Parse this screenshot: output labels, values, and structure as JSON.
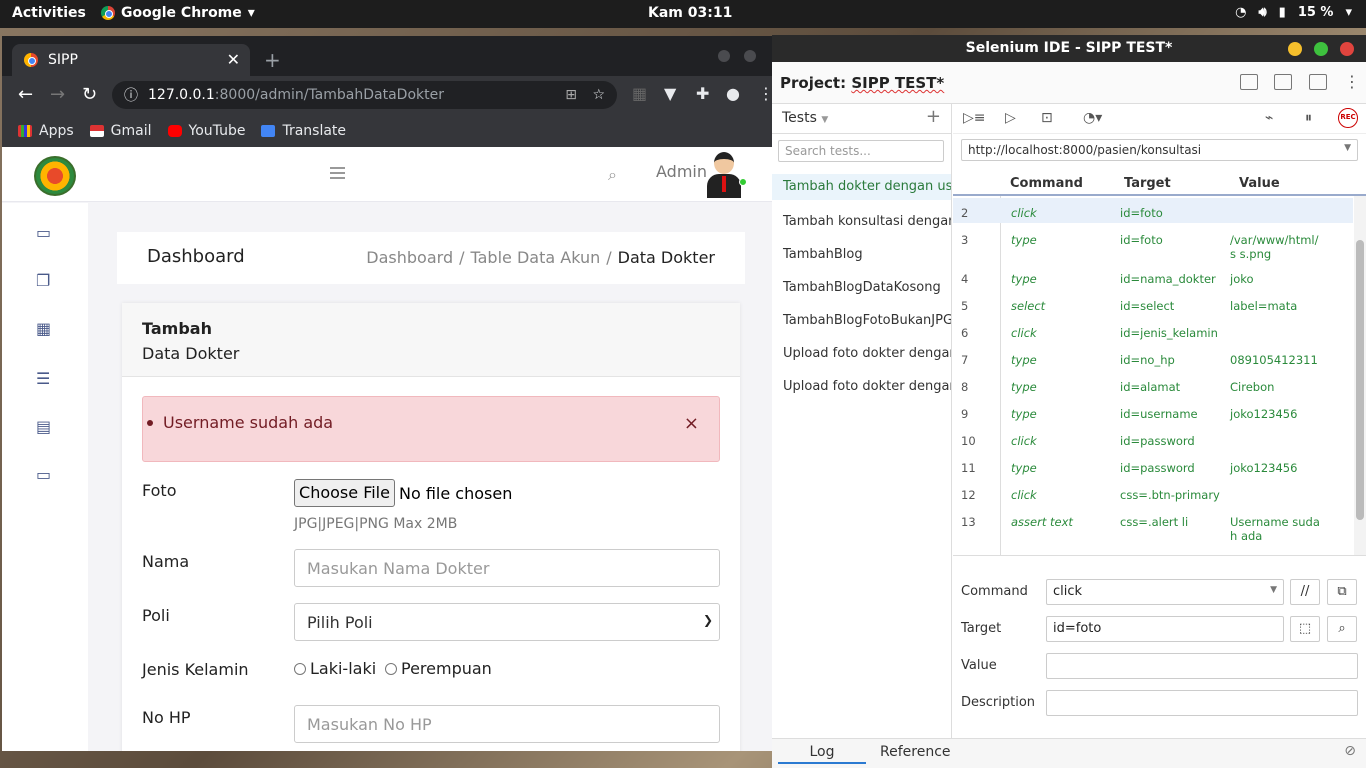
{
  "topbar": {
    "activities": "Activities",
    "app_name": "Google Chrome",
    "clock": "Kam 03:11",
    "battery": "15 %"
  },
  "browser": {
    "tab_title": "SIPP",
    "url_host": "127.0.0.1",
    "url_path": ":8000/admin/TambahDataDokter",
    "bookmarks": [
      "Apps",
      "Gmail",
      "YouTube",
      "Translate"
    ]
  },
  "page": {
    "admin_label": "Admin",
    "dashboard_title": "Dashboard",
    "breadcrumb": [
      "Dashboard",
      "Table Data Akun",
      "Data Dokter"
    ],
    "card_title": "Tambah",
    "card_subtitle": "Data Dokter",
    "alert_text": "Username sudah ada",
    "alert_close": "×",
    "fields": {
      "foto_label": "Foto",
      "file_button": "Choose File",
      "file_status": "No file chosen",
      "file_hint": "JPG|JPEG|PNG Max 2MB",
      "nama_label": "Nama",
      "nama_placeholder": "Masukan Nama Dokter",
      "poli_label": "Poli",
      "poli_value": "Pilih Poli",
      "jk_label": "Jenis Kelamin",
      "jk_options": [
        "Laki-laki",
        "Perempuan"
      ],
      "hp_label": "No HP",
      "hp_placeholder": "Masukan No HP"
    }
  },
  "selenium": {
    "window_title": "Selenium IDE - SIPP TEST*",
    "project_label": "Project:",
    "project_name": "SIPP TEST*",
    "tests_header": "Tests",
    "search_placeholder": "Search tests...",
    "tests": [
      "Tambah dokter dengan usern",
      "Tambah konsultasi dengan da",
      "TambahBlog",
      "TambahBlogDataKosong",
      "TambahBlogFotoBukanJPG,F",
      "Upload foto dokter dengan fo",
      "Upload foto dokter dengan uk"
    ],
    "base_url": "http://localhost:8000/pasien/konsultasi",
    "columns": [
      "Command",
      "Target",
      "Value"
    ],
    "rows": [
      {
        "n": "2",
        "command": "click",
        "target": "id=foto",
        "value": ""
      },
      {
        "n": "3",
        "command": "type",
        "target": "id=foto",
        "value": "/var/www/html/s s.png"
      },
      {
        "n": "4",
        "command": "type",
        "target": "id=nama_dokter",
        "value": "joko"
      },
      {
        "n": "5",
        "command": "select",
        "target": "id=select",
        "value": "label=mata"
      },
      {
        "n": "6",
        "command": "click",
        "target": "id=jenis_kelamin",
        "value": ""
      },
      {
        "n": "7",
        "command": "type",
        "target": "id=no_hp",
        "value": "089105412311"
      },
      {
        "n": "8",
        "command": "type",
        "target": "id=alamat",
        "value": "Cirebon"
      },
      {
        "n": "9",
        "command": "type",
        "target": "id=username",
        "value": "joko123456"
      },
      {
        "n": "10",
        "command": "click",
        "target": "id=password",
        "value": ""
      },
      {
        "n": "11",
        "command": "type",
        "target": "id=password",
        "value": "joko123456"
      },
      {
        "n": "12",
        "command": "click",
        "target": "css=.btn-primary",
        "value": ""
      },
      {
        "n": "13",
        "command": "assert text",
        "target": "css=.alert li",
        "value": "Username suda h ada"
      }
    ],
    "editor": {
      "command_label": "Command",
      "command_value": "click",
      "target_label": "Target",
      "target_value": "id=foto",
      "value_label": "Value",
      "description_label": "Description"
    },
    "footer": {
      "log": "Log",
      "reference": "Reference"
    },
    "rec_label": "REC"
  },
  "colors": {
    "accent_green": "#2a8a3b",
    "alert_bg": "#f8d7da",
    "selected_row": "#e8f0fa"
  }
}
